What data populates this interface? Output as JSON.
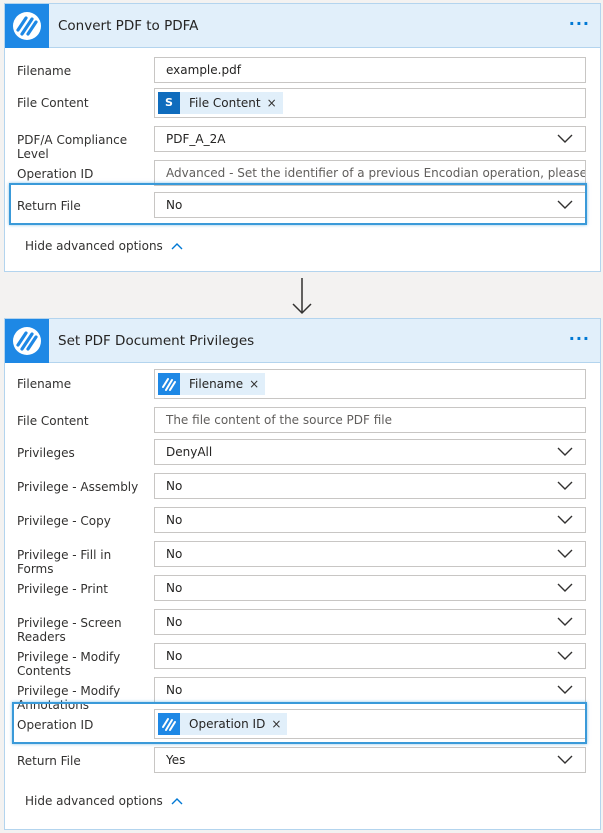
{
  "card1": {
    "title": "Convert PDF to PDFA",
    "more_label": "···",
    "rows": {
      "filename": {
        "label": "Filename",
        "value": "example.pdf"
      },
      "file_content": {
        "label": "File Content",
        "token": "File Content",
        "token_icon": "sharepoint-icon",
        "token_icon_text": "S"
      },
      "compliance": {
        "label": "PDF/A Compliance Level",
        "value": "PDF_A_2A"
      },
      "operation_id": {
        "label": "Operation ID",
        "placeholder": "Advanced - Set the identifier of a previous Encodian operation, please review k"
      },
      "return_file": {
        "label": "Return File",
        "value": "No"
      }
    },
    "advanced_label": "Hide advanced options"
  },
  "card2": {
    "title": "Set PDF Document Privileges",
    "more_label": "···",
    "rows": {
      "filename": {
        "label": "Filename",
        "token": "Filename",
        "token_icon": "encodian-icon"
      },
      "file_content": {
        "label": "File Content",
        "placeholder": "The file content of the source PDF file"
      },
      "privileges": {
        "label": "Privileges",
        "value": "DenyAll"
      },
      "assembly": {
        "label": "Privilege - Assembly",
        "value": "No"
      },
      "copy": {
        "label": "Privilege - Copy",
        "value": "No"
      },
      "fill_forms": {
        "label": "Privilege - Fill in Forms",
        "value": "No"
      },
      "print": {
        "label": "Privilege - Print",
        "value": "No"
      },
      "screen_readers": {
        "label": "Privilege - Screen Readers",
        "value": "No"
      },
      "modify_contents": {
        "label": "Privilege - Modify Contents",
        "value": "No"
      },
      "modify_annotations": {
        "label": "Privilege - Modify Annotations",
        "value": "No"
      },
      "operation_id": {
        "label": "Operation ID",
        "token": "Operation ID",
        "token_icon": "encodian-icon"
      },
      "return_file": {
        "label": "Return File",
        "value": "Yes"
      }
    },
    "advanced_label": "Hide advanced options"
  },
  "token_remove_glyph": "×",
  "colors": {
    "accent": "#0078d4",
    "header_bg": "#e1effa",
    "logo_bg": "#1e88e5",
    "highlight": "#3a9ad9"
  }
}
